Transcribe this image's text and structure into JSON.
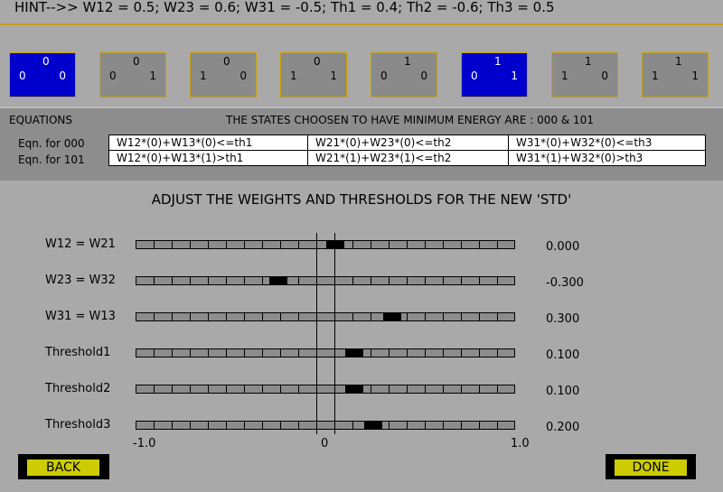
{
  "hint": "HINT-->> W12 = 0.5; W23 = 0.6; W31 = -0.5; Th1 = 0.4; Th2 = -0.6; Th3 = 0.5",
  "states": [
    {
      "bits": [
        "0",
        "0",
        "0"
      ],
      "selected": true
    },
    {
      "bits": [
        "0",
        "0",
        "1"
      ],
      "selected": false
    },
    {
      "bits": [
        "0",
        "1",
        "0"
      ],
      "selected": false
    },
    {
      "bits": [
        "0",
        "1",
        "1"
      ],
      "selected": false
    },
    {
      "bits": [
        "1",
        "0",
        "0"
      ],
      "selected": false
    },
    {
      "bits": [
        "1",
        "0",
        "1"
      ],
      "selected": true
    },
    {
      "bits": [
        "1",
        "1",
        "0"
      ],
      "selected": false
    },
    {
      "bits": [
        "1",
        "1",
        "1"
      ],
      "selected": false
    }
  ],
  "equations": {
    "title": "EQUATIONS",
    "note": "THE STATES CHOOSEN TO HAVE MINIMUM ENERGY ARE : 000 & 101",
    "rows": [
      {
        "label": "Eqn. for 000",
        "cells": [
          "W12*(0)+W13*(0)<=th1",
          "W21*(0)+W23*(0)<=th2",
          "W31*(0)+W32*(0)<=th3"
        ]
      },
      {
        "label": "Eqn. for 101",
        "cells": [
          "W12*(0)+W13*(1)>th1",
          "W21*(1)+W23*(1)<=th2",
          "W31*(1)+W32*(0)>th3"
        ]
      }
    ]
  },
  "adjust_title": "ADJUST THE WEIGHTS AND THRESHOLDS FOR THE NEW 'STD'",
  "sliders": [
    {
      "label": "W12 = W21",
      "value": 0.0,
      "display": "0.000"
    },
    {
      "label": "W23 = W32",
      "value": -0.3,
      "display": "-0.300"
    },
    {
      "label": "W31 = W13",
      "value": 0.3,
      "display": "0.300"
    },
    {
      "label": "Threshold1",
      "value": 0.1,
      "display": "0.100"
    },
    {
      "label": "Threshold2",
      "value": 0.1,
      "display": "0.100"
    },
    {
      "label": "Threshold3",
      "value": 0.2,
      "display": "0.200"
    }
  ],
  "axis": {
    "min_label": "-1.0",
    "zero_label": "0",
    "max_label": "1.0",
    "min": -1.0,
    "max": 1.0
  },
  "buttons": {
    "back": "BACK",
    "done": "DONE"
  },
  "colors": {
    "selected_state": "#0000cc",
    "button": "#cccc00"
  }
}
